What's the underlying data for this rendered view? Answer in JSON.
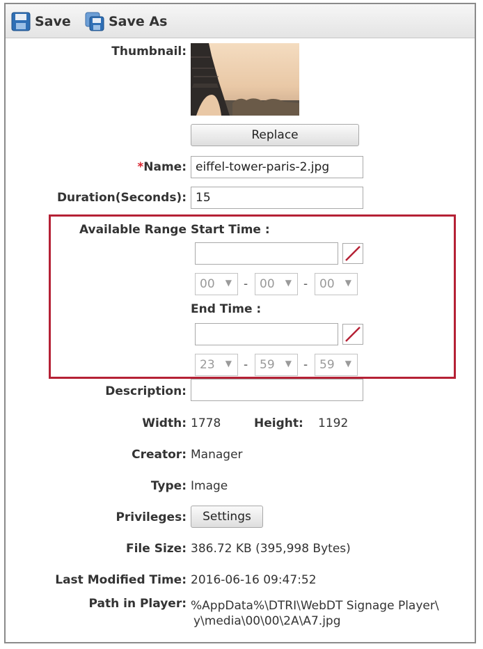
{
  "toolbar": {
    "save_label": "Save",
    "save_as_label": "Save As"
  },
  "form": {
    "thumbnail_label": "Thumbnail:",
    "replace_label": "Replace",
    "required_mark": "*",
    "name_label": "Name:",
    "name_value": "eiffel-tower-paris-2.jpg",
    "duration_label": "Duration(Seconds):",
    "duration_value": "15",
    "available_range_label": "Available Range",
    "start_time_label": "Start Time :",
    "start_hour": "00",
    "start_minute": "00",
    "start_second": "00",
    "end_time_label": "End Time :",
    "end_hour": "23",
    "end_minute": "59",
    "end_second": "59",
    "dash": "-",
    "description_label": "Description:",
    "description_value": "",
    "width_label": "Width:",
    "width_value": "1778",
    "height_label": "Height:",
    "height_value": "1192",
    "creator_label": "Creator:",
    "creator_value": "Manager",
    "type_label": "Type:",
    "type_value": "Image",
    "privileges_label": "Privileges:",
    "settings_label": "Settings",
    "file_size_label": "File Size:",
    "file_size_value": "386.72 KB (395,998 Bytes)",
    "last_modified_label": "Last Modified Time:",
    "last_modified_value": "2016-06-16 09:47:52",
    "path_label": "Path in Player:",
    "path_line1": "%AppData%\\DTRI\\WebDT Signage Player\\",
    "path_line2": "y\\media\\00\\00\\2A\\A7.jpg"
  },
  "colors": {
    "highlight": "#b52135",
    "required": "#d9232e"
  },
  "icons": {
    "save": "floppy-disk-icon",
    "save_as": "floppy-disk-stack-icon",
    "clear": "clear-date-icon",
    "dropdown": "triangle-down-icon"
  }
}
